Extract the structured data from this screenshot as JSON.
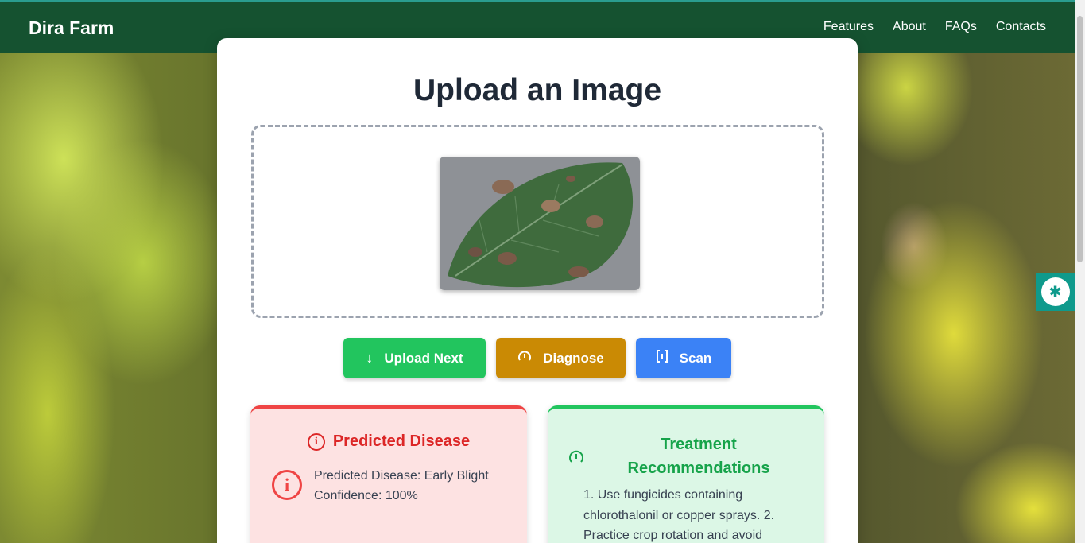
{
  "navbar": {
    "brand": "Dira Farm",
    "links": [
      "Features",
      "About",
      "FAQs",
      "Contacts"
    ]
  },
  "upload": {
    "title": "Upload an Image",
    "buttons": {
      "upload_next": "Upload Next",
      "diagnose": "Diagnose",
      "scan": "Scan"
    }
  },
  "prediction": {
    "heading": "Predicted Disease",
    "disease_line": "Predicted Disease: Early Blight",
    "confidence_line": "Confidence: 100%"
  },
  "treatment": {
    "heading_line1": "Treatment",
    "heading_line2": "Recommendations",
    "text": "1. Use fungicides containing chlorothalonil or copper sprays. 2. Practice crop rotation and avoid"
  },
  "colors": {
    "navbar": "#155230",
    "upload_button": "#22c55e",
    "diagnose_button": "#ca8a04",
    "scan_button": "#3b82f6",
    "disease_accent": "#ef4444",
    "treatment_accent": "#22c55e"
  },
  "icons": {
    "upload_next": "arrow-down-icon",
    "diagnose": "gauge-icon",
    "scan": "scan-brackets-icon",
    "disease": "info-circle-icon",
    "treatment": "gauge-icon",
    "widget": "widget-logo-icon"
  }
}
